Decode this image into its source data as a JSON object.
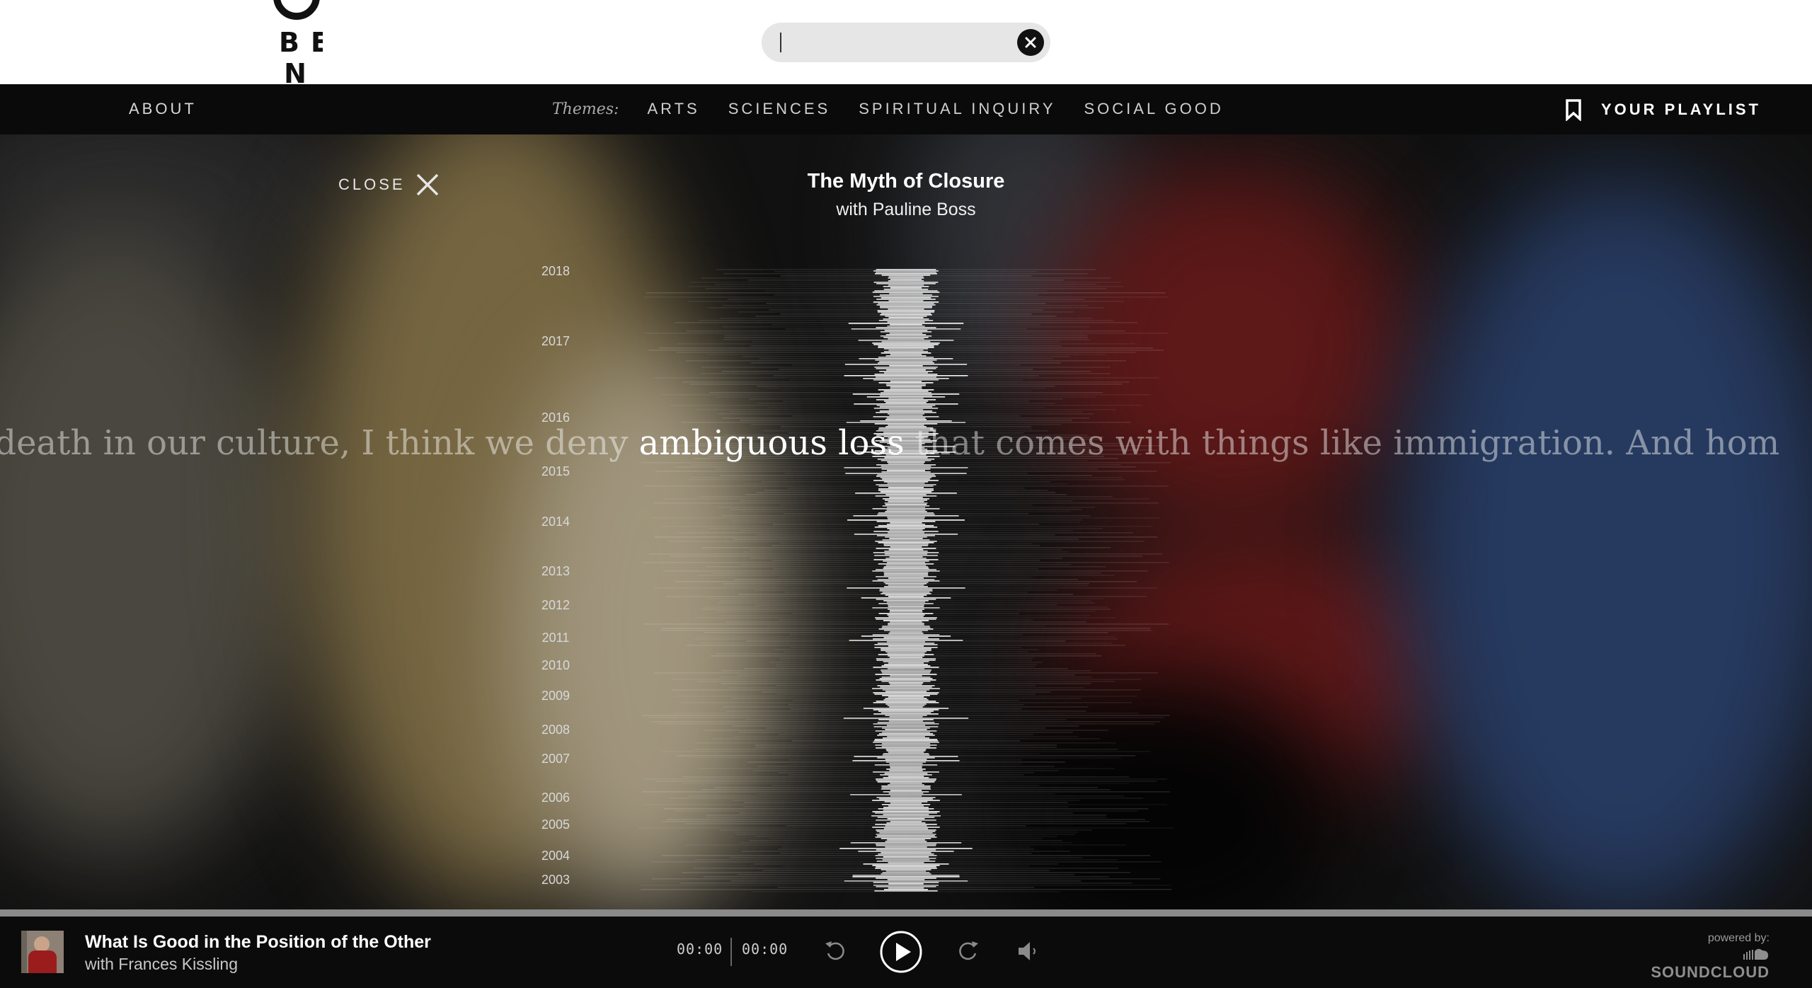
{
  "search": {
    "value": "",
    "placeholder": ""
  },
  "nav": {
    "about_label": "ABOUT",
    "themes_label": "Themes:",
    "themes": [
      "ARTS",
      "SCIENCES",
      "SPIRITUAL INQUIRY",
      "SOCIAL GOOD"
    ],
    "playlist_label": "YOUR PLAYLIST"
  },
  "detail": {
    "close_label": "CLOSE",
    "title": "The Myth of Closure",
    "guest": "with Pauline Boss",
    "years": [
      "2018",
      "2017",
      "2016",
      "2015",
      "2014",
      "2013",
      "2012",
      "2011",
      "2010",
      "2009",
      "2008",
      "2007",
      "2006",
      "2005",
      "2004",
      "2003"
    ],
    "quote_before": "deny death in our culture, I think we deny ",
    "quote_highlight": "ambiguous loss",
    "quote_after": " that comes with things like immigration. And hom"
  },
  "player": {
    "track_title": "What Is Good in the Position of the Other",
    "track_guest": "with Frances Kissling",
    "current_time": "00:00",
    "duration": "00:00",
    "powered_by": "powered by:",
    "provider": "SOUNDCLOUD"
  },
  "colors": {
    "navbar_bg": "#0a0a0a",
    "player_bg": "#0b0b0b",
    "search_bg": "#e6e6e6"
  }
}
